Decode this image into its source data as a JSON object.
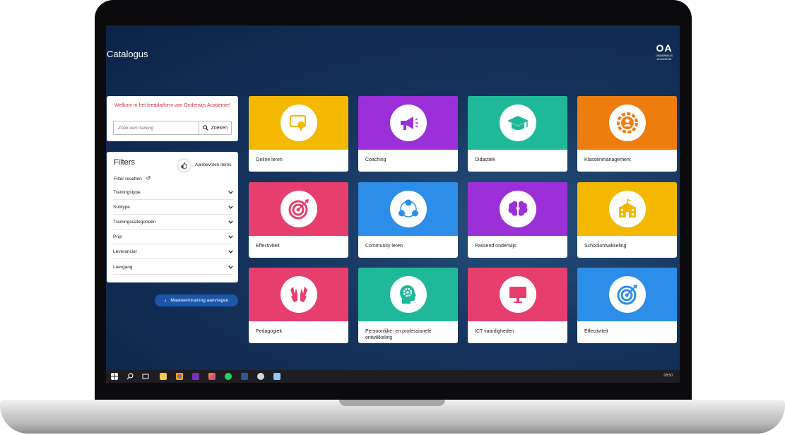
{
  "app": {
    "title": "Catalogus"
  },
  "logo": {
    "mark": "OA",
    "line1": "ONDERWIJS",
    "line2": "ACADEMIE"
  },
  "welcome": {
    "message": "Welkom in het leerplatform van Onderwijs Academie!"
  },
  "search": {
    "placeholder": "Zoek een training",
    "button_label": "Zoeken"
  },
  "filters": {
    "title": "Filters",
    "recommended_label": "Aanbevolen items",
    "reset_label": "Filter resetten",
    "rows": [
      {
        "label": "Trainingstype"
      },
      {
        "label": "Subtype"
      },
      {
        "label": "Trainingscategorieën"
      },
      {
        "label": "Prijs"
      },
      {
        "label": "Leverancier"
      },
      {
        "label": "Leergang"
      }
    ]
  },
  "custom_training": {
    "label": "Maatwerktraining aanvragen"
  },
  "cards": [
    {
      "label": "Online leren",
      "color": "#f5b800",
      "icon": "touch-screen-icon"
    },
    {
      "label": "Coaching",
      "color": "#9b30d9",
      "icon": "megaphone-icon"
    },
    {
      "label": "Didactiek",
      "color": "#1fb99a",
      "icon": "graduation-cap-icon"
    },
    {
      "label": "Klassenmanagement",
      "color": "#ee7d0f",
      "icon": "gear-person-icon"
    },
    {
      "label": "Effectiviteit",
      "color": "#e63e6d",
      "icon": "target-icon"
    },
    {
      "label": "Community leren",
      "color": "#2c8ee8",
      "icon": "community-icon"
    },
    {
      "label": "Passend onderwijs",
      "color": "#9b30d9",
      "icon": "puzzle-brain-icon"
    },
    {
      "label": "Schoolontwikkeling",
      "color": "#f5b800",
      "icon": "school-icon"
    },
    {
      "label": "Pedagogiek",
      "color": "#e63e6d",
      "icon": "hands-icon"
    },
    {
      "label": "Persoonlijke- en professionele ontwikkeling",
      "color": "#1fb99a",
      "icon": "head-gear-icon"
    },
    {
      "label": "ICT vaardigheden",
      "color": "#e63e6d",
      "icon": "monitor-icon"
    },
    {
      "label": "Effectiviteit",
      "color": "#2c8ee8",
      "icon": "target-icon"
    }
  ],
  "taskbar": {
    "time": "08:50"
  }
}
